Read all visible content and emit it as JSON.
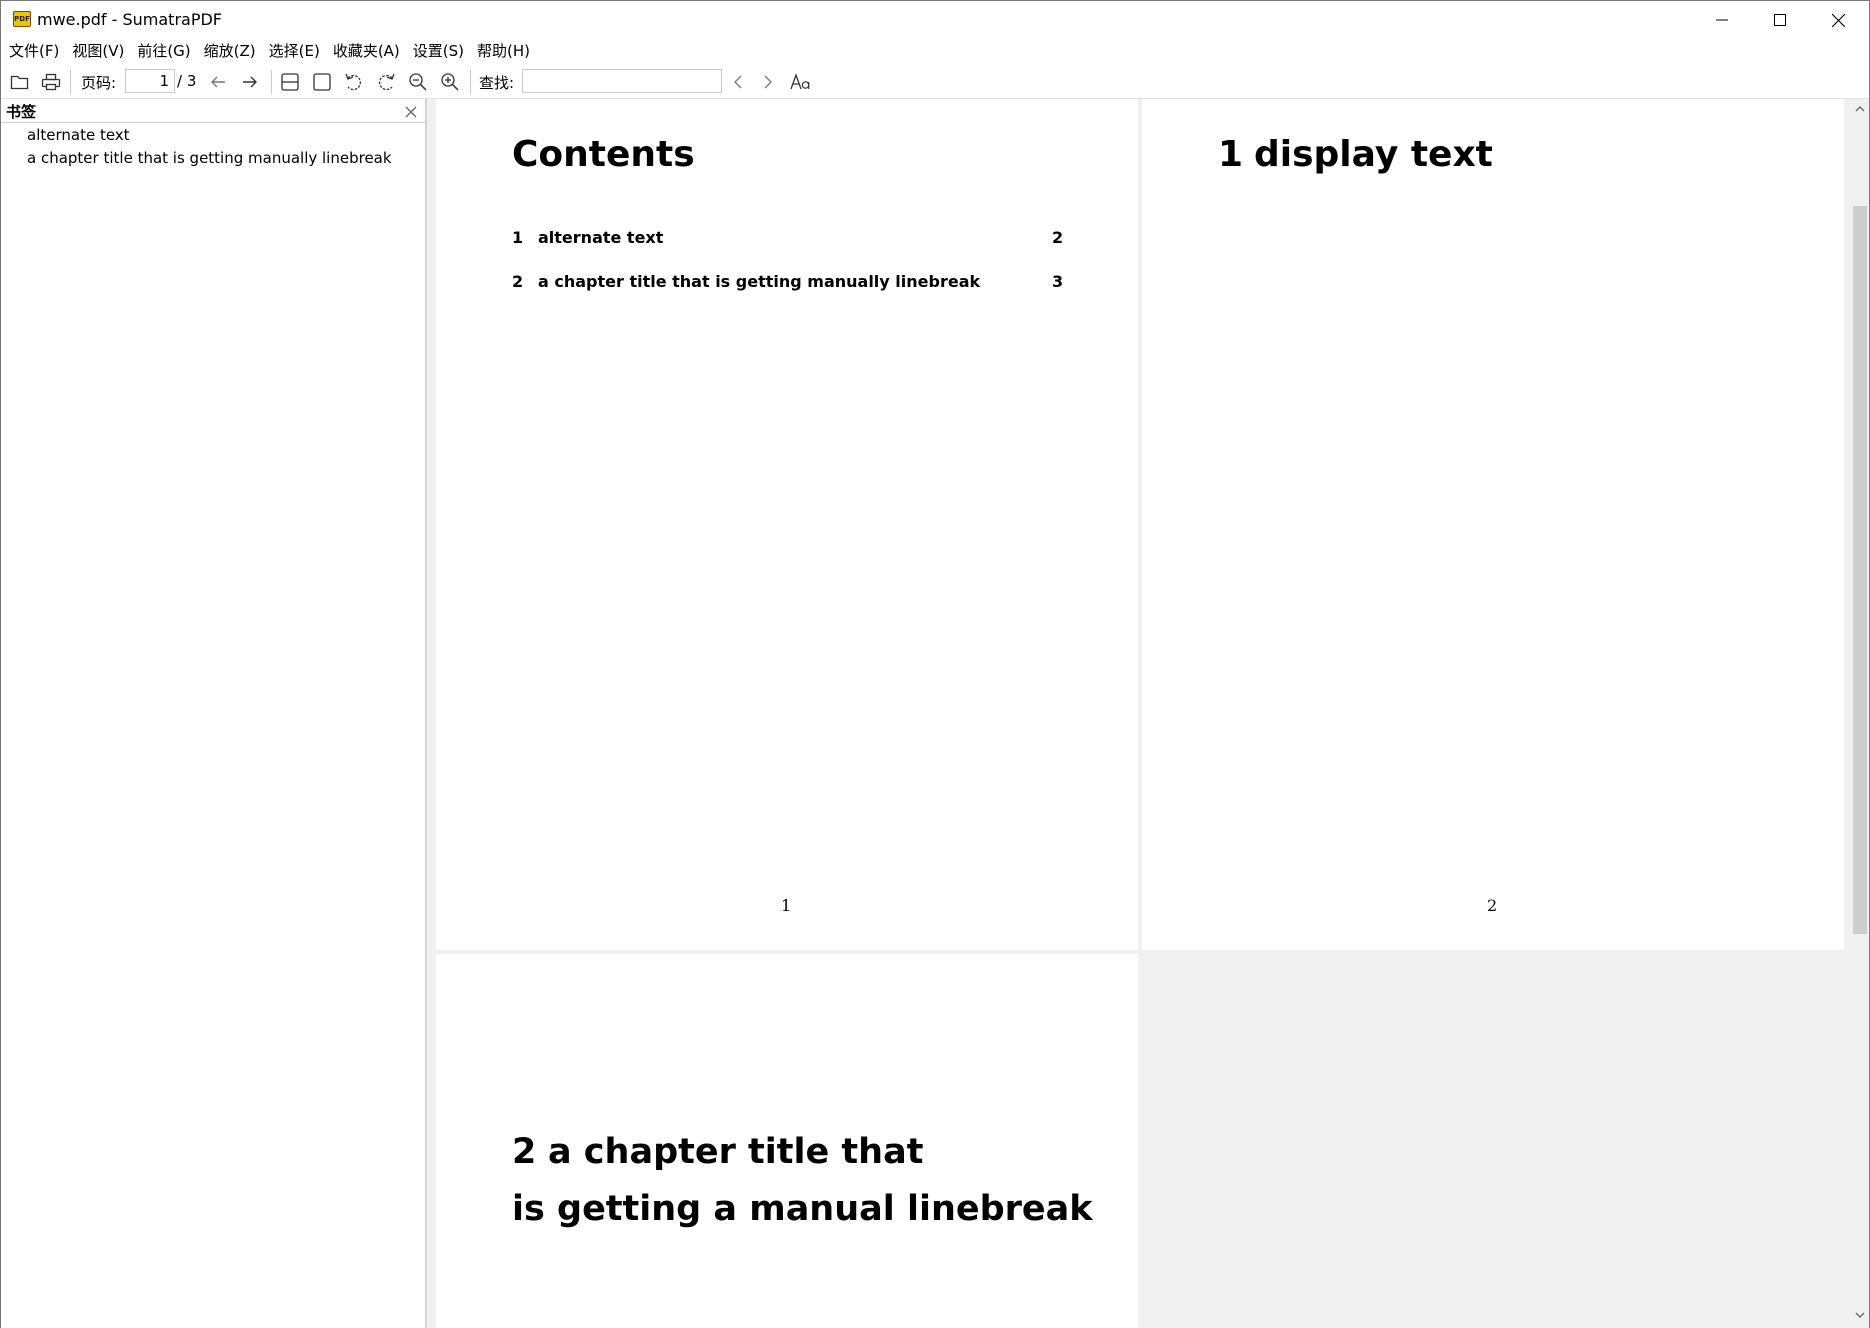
{
  "window": {
    "title": "mwe.pdf - SumatraPDF",
    "app_icon_text": "PDF"
  },
  "menu": {
    "items": [
      "文件(F)",
      "视图(V)",
      "前往(G)",
      "缩放(Z)",
      "选择(E)",
      "收藏夹(A)",
      "设置(S)",
      "帮助(H)"
    ]
  },
  "toolbar": {
    "page_label": "页码:",
    "page_current": "1",
    "page_total": "/ 3",
    "find_label": "查找:",
    "find_value": ""
  },
  "sidebar": {
    "title": "书签",
    "bookmarks": [
      "alternate text",
      "a chapter title that is getting manually linebreak"
    ]
  },
  "document": {
    "page1": {
      "heading": "Contents",
      "toc": [
        {
          "num": "1",
          "title": "alternate text",
          "page": "2"
        },
        {
          "num": "2",
          "title": "a chapter title that is getting manually linebreak",
          "page": "3"
        }
      ],
      "footer_number": "1"
    },
    "page2": {
      "chapter_num": "1",
      "chapter_title": "display text",
      "footer_number": "2"
    },
    "page3": {
      "chapter_num": "2",
      "chapter_title_line1": "a chapter title that",
      "chapter_title_line2": "is getting a manual linebreak"
    }
  }
}
